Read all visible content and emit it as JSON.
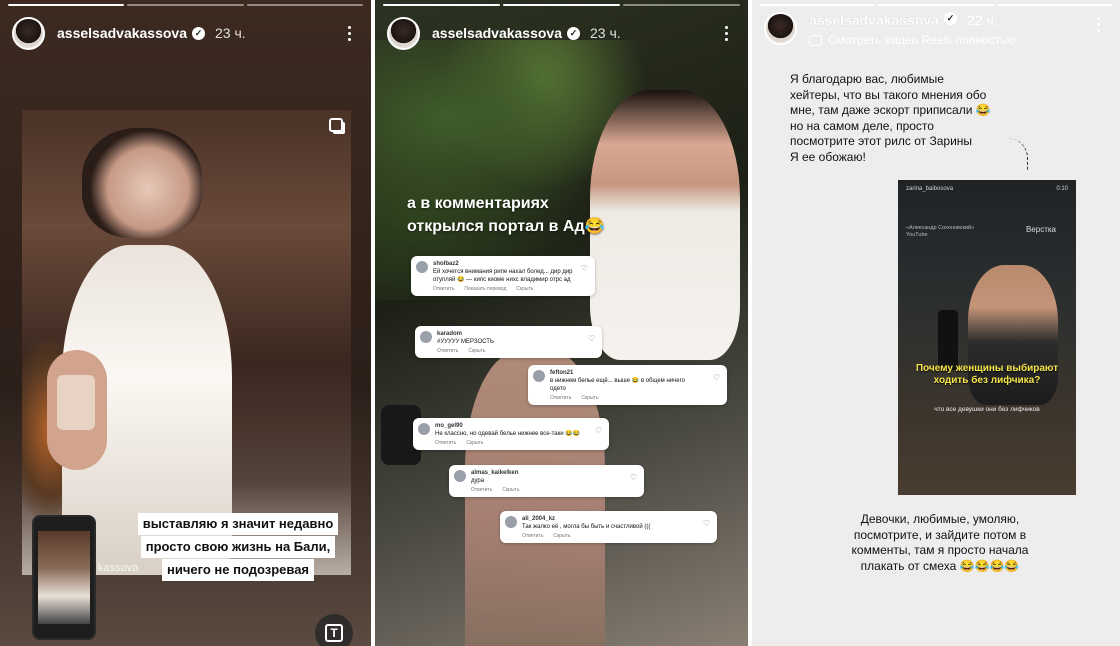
{
  "stories": [
    {
      "username": "asselsadvakassova",
      "time": "23 ч.",
      "handle_text": "kassova",
      "caption_lines": [
        "выставляю я значит недавно",
        "просто свою жизнь на Бали,",
        "ничего не подозревая"
      ]
    },
    {
      "username": "asselsadvakassova",
      "time": "23 ч.",
      "headline_lines": [
        "а в комментариях",
        "открылся портал в Ад😂"
      ],
      "comments": [
        {
          "user": "sholbaz2",
          "text": "Ей хочется внимания рипе нахал болед... дир дир отупляй 😂 — кипс киоме нихс владимир отрс ад",
          "actions": [
            "Ответить",
            "Показать перевод",
            "Скрыть"
          ],
          "count": "11"
        },
        {
          "user": "karadom",
          "text": "#УУУУУ МЕРЗОСТЬ",
          "actions": [
            "Ответить",
            "Скрыть"
          ],
          "count": ""
        },
        {
          "user": "fefton21",
          "text": "в нижнем белье ещё... выше 😂 в общем ничего одето",
          "actions": [
            "Ответить",
            "Скрыть"
          ],
          "count": ""
        },
        {
          "user": "mo_gel90",
          "text": "Не классно, но одевай белье нижнее все-таки 😂😂",
          "actions": [
            "Ответить",
            "Скрыть"
          ],
          "count": "16"
        },
        {
          "user": "almas_kaikelken",
          "text": "дура",
          "actions": [
            "Ответить",
            "Скрыть"
          ],
          "count": ""
        },
        {
          "user": "ali_2004_kz",
          "text": "Так жалко её , могла бы быть и счастливой (((",
          "actions": [
            "Ответить",
            "Скрыть"
          ],
          "count": ""
        }
      ]
    },
    {
      "username": "asselsadvakassova",
      "time": "22 ч.",
      "reels_link": "Смотреть видео Reels полностью",
      "top_text": [
        "Я благодарю вас, любимые",
        "хейтеры, что вы такого мнения обо",
        "мне, там даже эскорт приписали 😂",
        "но на самом деле, просто",
        "посмотрите этот рилс от Зарины",
        "Я ее обожаю!"
      ],
      "reel": {
        "author": "zarina_baibosova",
        "time": "0:10",
        "subtitle": "«Александр Сохоновский» YouTube",
        "brand": "Верстка",
        "caption": "Почему женщины выбирают ходить без лифчика?",
        "caption2": "что все девушки они без лифчиков"
      },
      "bottom_text": [
        "Девочки, любимые, умоляю,",
        "посмотрите, и зайдите потом в",
        "комменты, там я просто начала",
        "плакать от смеха 😂😂😂😂"
      ]
    }
  ],
  "icons": [
    "verified-badge-icon",
    "more-options-icon",
    "multi-photo-icon",
    "text-tool-icon",
    "heart-icon",
    "camera-reels-icon"
  ]
}
